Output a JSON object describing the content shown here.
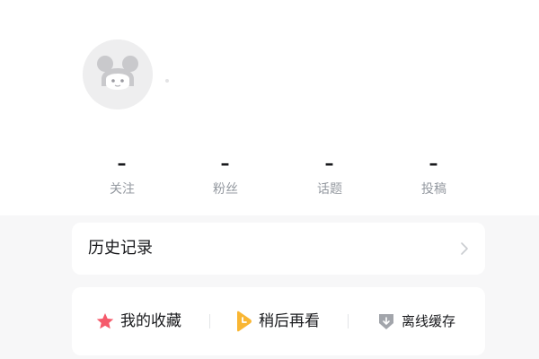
{
  "profile": {
    "avatar_icon": "default-girl-avatar-icon"
  },
  "stats": [
    {
      "value": "–",
      "label": "关注"
    },
    {
      "value": "–",
      "label": "粉丝"
    },
    {
      "value": "–",
      "label": "话题"
    },
    {
      "value": "–",
      "label": "投稿"
    }
  ],
  "history": {
    "title": "历史记录",
    "icon": "chevron-right-icon"
  },
  "shortcuts": [
    {
      "label": "我的收藏",
      "icon": "star-icon",
      "color": "#f55a6b"
    },
    {
      "label": "稍后再看",
      "icon": "play-later-icon",
      "color": "#f9b633"
    },
    {
      "label": "离线缓存",
      "icon": "download-icon",
      "color": "#a2a5ab"
    }
  ],
  "colors": {
    "background": "#f7f7f8",
    "card": "#ffffff",
    "text_primary": "#18191c",
    "text_secondary": "#9499a0"
  }
}
